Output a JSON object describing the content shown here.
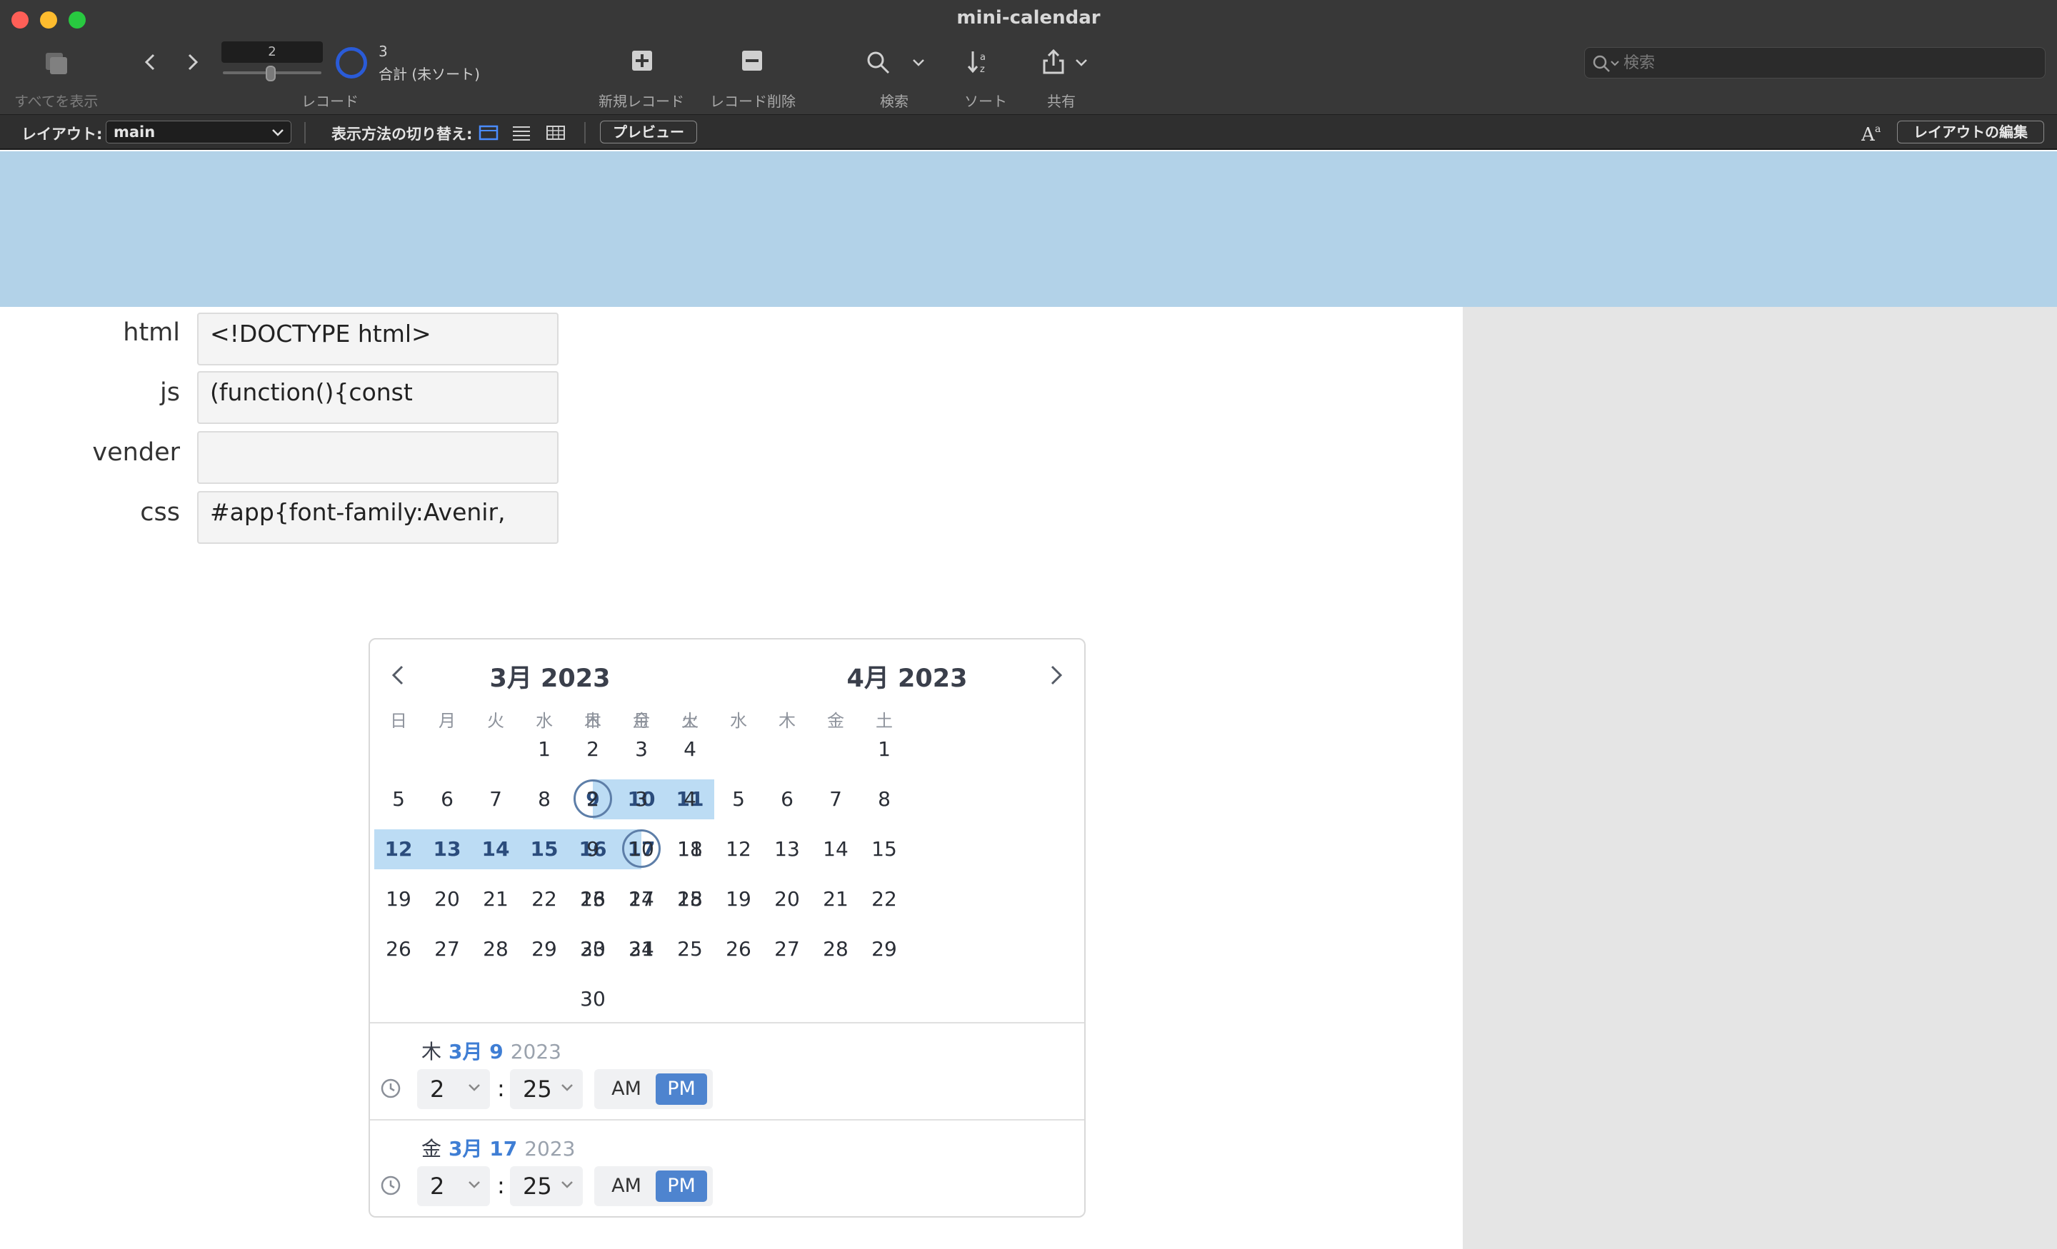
{
  "window": {
    "title": "mini-calendar"
  },
  "toolbar": {
    "show_all": "すべてを表示",
    "record_group": "レコード",
    "current_record": "2",
    "found_count": "3",
    "sort_status": "合計 (未ソート)",
    "new_record": "新規レコード",
    "delete_record": "レコード削除",
    "find": "検索",
    "sort": "ソート",
    "share": "共有",
    "search_placeholder": "検索"
  },
  "layoutbar": {
    "layout_label": "レイアウト:",
    "layout_value": "main",
    "view_label": "表示方法の切り替え:",
    "preview": "プレビュー",
    "edit_layout": "レイアウトの編集"
  },
  "fields": [
    {
      "label": "html",
      "value": "<!DOCTYPE html>"
    },
    {
      "label": "js",
      "value": "(function(){const"
    },
    {
      "label": "vender",
      "value": ""
    },
    {
      "label": "css",
      "value": "#app{font-family:Avenir,"
    }
  ],
  "calendar": {
    "months": [
      {
        "title": "3月 2023",
        "first_weekday": 3,
        "days": 31
      },
      {
        "title": "4月 2023",
        "first_weekday": 6,
        "days": 30
      }
    ],
    "weekdays": [
      "日",
      "月",
      "火",
      "水",
      "木",
      "金",
      "土"
    ],
    "range_start": 9,
    "range_end": 17,
    "start": {
      "dow": "木",
      "month_day": "3月 9",
      "year": "2023",
      "hour": "2",
      "minute": "25",
      "am": "AM",
      "pm": "PM",
      "selected": "PM"
    },
    "end": {
      "dow": "金",
      "month_day": "3月 17",
      "year": "2023",
      "hour": "2",
      "minute": "25",
      "am": "AM",
      "pm": "PM",
      "selected": "PM"
    }
  },
  "colors": {
    "banner": "#b2d2e8",
    "range": "#bcdcf4",
    "accent": "#4e84cf"
  }
}
